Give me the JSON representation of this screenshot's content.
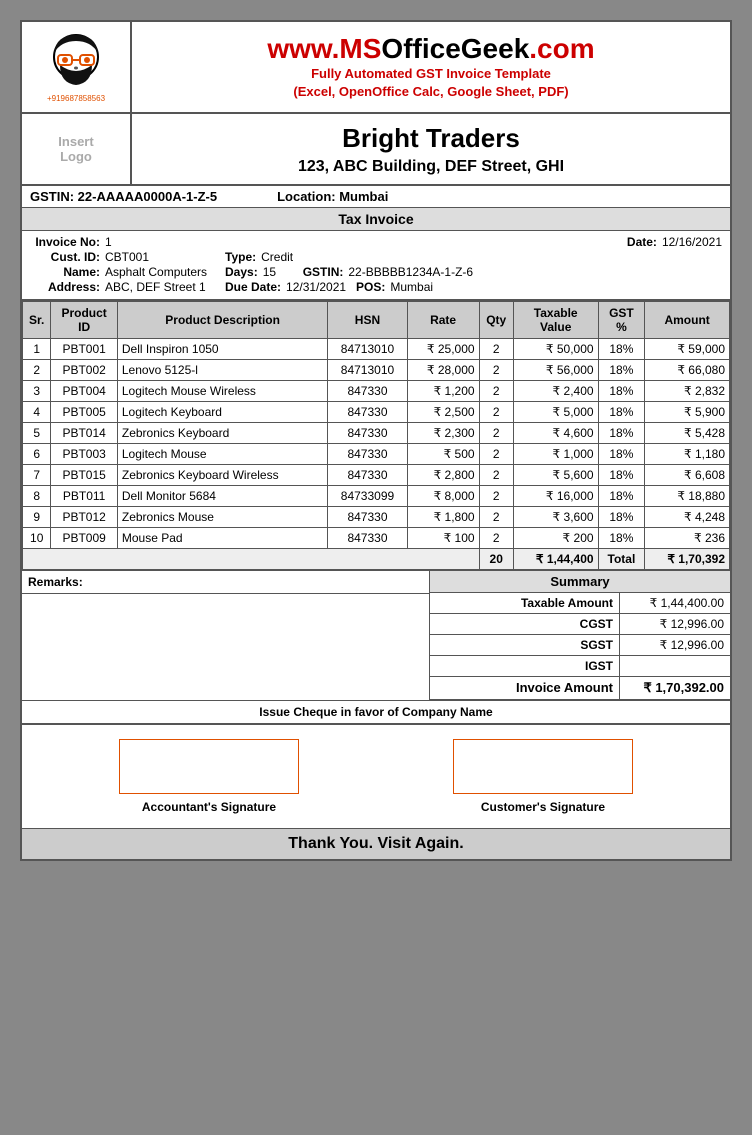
{
  "header": {
    "site": "www.MSOfficeGeek.com",
    "ms_part": "www.",
    "ms_color": "#cc0000",
    "subtitle_line1": "Fully Automated GST Invoice Template",
    "subtitle_line2": "(Excel, OpenOffice Calc, Google Sheet, PDF)",
    "phone": "+919687858563"
  },
  "company": {
    "logo_placeholder": "Insert\nLogo",
    "name": "Bright Traders",
    "address": "123, ABC Building, DEF Street, GHI",
    "gstin": "GSTIN: 22-AAAAA0000A-1-Z-5",
    "location": "Location:  Mumbai",
    "doc_type": "Tax Invoice"
  },
  "invoice": {
    "number_label": "Invoice No:",
    "number_value": "1",
    "date_label": "Date:",
    "date_value": "12/16/2021",
    "cust_id_label": "Cust. ID:",
    "cust_id_value": "CBT001",
    "type_label": "Type:",
    "type_value": "Credit",
    "name_label": "Name:",
    "name_value": "Asphalt Computers",
    "days_label": "Days:",
    "days_value": "15",
    "gstin_label": "GSTIN:",
    "gstin_value": "22-BBBBB1234A-1-Z-6",
    "address_label": "Address:",
    "address_value": "ABC, DEF Street 1",
    "due_date_label": "Due Date:",
    "due_date_value": "12/31/2021",
    "pos_label": "POS:",
    "pos_value": "Mumbai"
  },
  "table": {
    "headers": [
      "Sr.",
      "Product\nID",
      "Product Description",
      "HSN",
      "Rate",
      "Qty",
      "Taxable\nValue",
      "GST\n%",
      "Amount"
    ],
    "rows": [
      {
        "sr": "1",
        "prod_id": "PBT001",
        "desc": "Dell Inspiron 1050",
        "hsn": "84713010",
        "rate": "₹ 25,000",
        "qty": "2",
        "taxable": "₹ 50,000",
        "gst": "18%",
        "amount": "₹ 59,000"
      },
      {
        "sr": "2",
        "prod_id": "PBT002",
        "desc": "Lenovo 5125-l",
        "hsn": "84713010",
        "rate": "₹ 28,000",
        "qty": "2",
        "taxable": "₹ 56,000",
        "gst": "18%",
        "amount": "₹ 66,080"
      },
      {
        "sr": "3",
        "prod_id": "PBT004",
        "desc": "Logitech Mouse Wireless",
        "hsn": "847330",
        "rate": "₹ 1,200",
        "qty": "2",
        "taxable": "₹ 2,400",
        "gst": "18%",
        "amount": "₹ 2,832"
      },
      {
        "sr": "4",
        "prod_id": "PBT005",
        "desc": "Logitech Keyboard",
        "hsn": "847330",
        "rate": "₹ 2,500",
        "qty": "2",
        "taxable": "₹ 5,000",
        "gst": "18%",
        "amount": "₹ 5,900"
      },
      {
        "sr": "5",
        "prod_id": "PBT014",
        "desc": "Zebronics Keyboard",
        "hsn": "847330",
        "rate": "₹ 2,300",
        "qty": "2",
        "taxable": "₹ 4,600",
        "gst": "18%",
        "amount": "₹ 5,428"
      },
      {
        "sr": "6",
        "prod_id": "PBT003",
        "desc": "Logitech Mouse",
        "hsn": "847330",
        "rate": "₹ 500",
        "qty": "2",
        "taxable": "₹ 1,000",
        "gst": "18%",
        "amount": "₹ 1,180"
      },
      {
        "sr": "7",
        "prod_id": "PBT015",
        "desc": "Zebronics Keyboard Wireless",
        "hsn": "847330",
        "rate": "₹ 2,800",
        "qty": "2",
        "taxable": "₹ 5,600",
        "gst": "18%",
        "amount": "₹ 6,608"
      },
      {
        "sr": "8",
        "prod_id": "PBT011",
        "desc": "Dell Monitor 5684",
        "hsn": "84733099",
        "rate": "₹ 8,000",
        "qty": "2",
        "taxable": "₹ 16,000",
        "gst": "18%",
        "amount": "₹ 18,880"
      },
      {
        "sr": "9",
        "prod_id": "PBT012",
        "desc": "Zebronics Mouse",
        "hsn": "847330",
        "rate": "₹ 1,800",
        "qty": "2",
        "taxable": "₹ 3,600",
        "gst": "18%",
        "amount": "₹ 4,248"
      },
      {
        "sr": "10",
        "prod_id": "PBT009",
        "desc": "Mouse Pad",
        "hsn": "847330",
        "rate": "₹ 100",
        "qty": "2",
        "taxable": "₹ 200",
        "gst": "18%",
        "amount": "₹ 236"
      }
    ],
    "totals": {
      "qty": "20",
      "taxable": "₹ 1,44,400",
      "total_label": "Total",
      "amount": "₹ 1,70,392"
    }
  },
  "remarks": {
    "label": "Remarks:"
  },
  "summary": {
    "title": "Summary",
    "rows": [
      {
        "label": "Taxable Amount",
        "value": "₹ 1,44,400.00"
      },
      {
        "label": "CGST",
        "value": "₹ 12,996.00"
      },
      {
        "label": "SGST",
        "value": "₹ 12,996.00"
      },
      {
        "label": "IGST",
        "value": ""
      },
      {
        "label": "Invoice Amount",
        "value": "₹ 1,70,392.00"
      }
    ]
  },
  "cheque": {
    "text": "Issue Cheque in favor of Company Name"
  },
  "signatures": {
    "accountant_label": "Accountant's Signature",
    "customer_label": "Customer's Signature"
  },
  "footer": {
    "text": "Thank You. Visit Again."
  }
}
